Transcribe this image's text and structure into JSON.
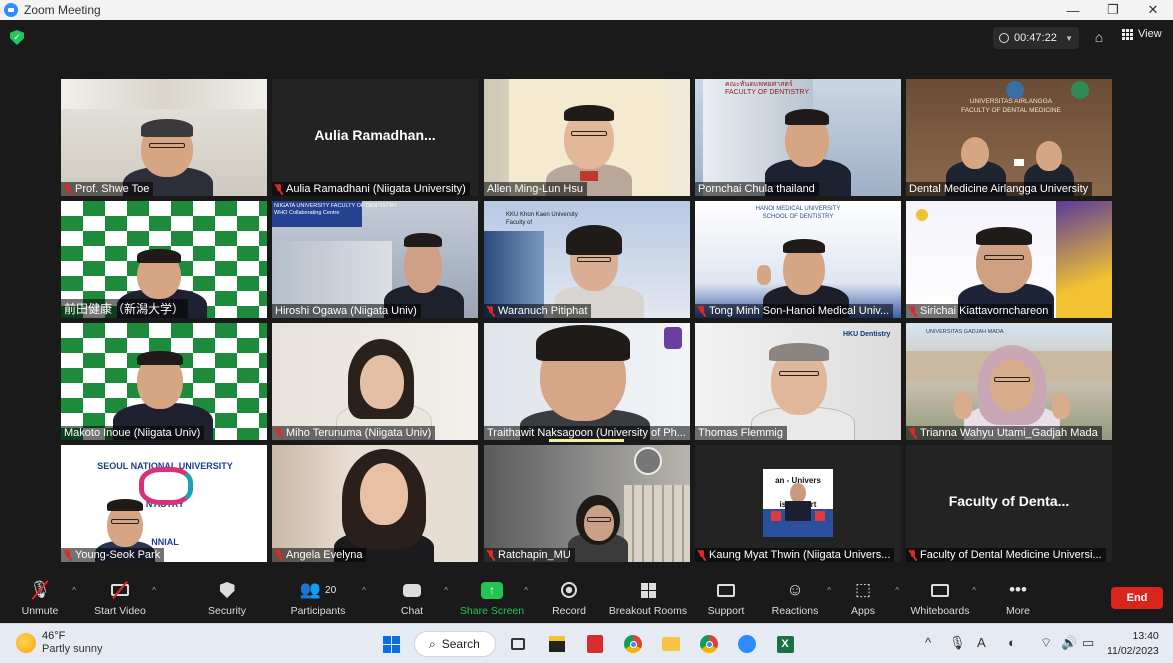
{
  "window": {
    "title": "Zoom Meeting"
  },
  "header": {
    "timer": "00:47:22",
    "view_label": "View"
  },
  "participants": [
    {
      "name": "Prof. Shwe Toe",
      "muted": true
    },
    {
      "name": "Aulia Ramadhani (Niigata University)",
      "muted": true,
      "display_text": "Aulia  Ramadhan..."
    },
    {
      "name": "Allen Ming-Lun Hsu",
      "muted": false
    },
    {
      "name": "Pornchai Chula thailand",
      "muted": false,
      "bg_text": "คณะทันตแพทยศาสตร์\nFACULTY OF DENTISTRY"
    },
    {
      "name": "Dental Medicine Airlangga University",
      "muted": false,
      "bg_text": "UNIVERSITAS AIRLANGGA\nFACULTY OF DENTAL MEDICINE"
    },
    {
      "name": "前田健康（新潟大学）",
      "muted": false,
      "active": true
    },
    {
      "name": "Hiroshi Ogawa (Niigata Univ)",
      "muted": false,
      "bg_text": "NIIGATA UNIVERSITY FACULTY OF DENTISTRY\nWHO Collaborating Centre"
    },
    {
      "name": "Waranuch Pitiphat",
      "muted": true,
      "bg_text": "KKU Khon Kaen University\nFaculty of"
    },
    {
      "name": "Tong Minh Son-Hanoi Medical Univ...",
      "muted": true,
      "bg_text": "HANOI MEDICAL UNIVERSITY\nSCHOOL OF DENTISTRY"
    },
    {
      "name": "Sirichai Kiattavornchareon",
      "muted": true
    },
    {
      "name": "Makoto Inoue (Niigata Univ)",
      "muted": false
    },
    {
      "name": "Miho Terunuma (Niigata Univ)",
      "muted": true
    },
    {
      "name": "Traithawit Naksagoon (University of Ph...",
      "muted": false
    },
    {
      "name": "Thomas Flemmig",
      "muted": false,
      "bg_text": "HKU Dentistry"
    },
    {
      "name": "Trianna Wahyu Utami_Gadjah Mada",
      "muted": true,
      "bg_text": "UNIVERSITAS GADJAH MADA"
    },
    {
      "name": "Young-Seok Park",
      "muted": true,
      "bg_text": "SEOUL NATIONAL UNIVERSITY\nNTISTRY\nNNIAL"
    },
    {
      "name": "Angela Evelyna",
      "muted": true
    },
    {
      "name": "Ratchapin_MU",
      "muted": true
    },
    {
      "name": "Kaung Myat Thwin (Niigata Univers...",
      "muted": true,
      "bg_text": "an - Univers\niscu  Kort"
    },
    {
      "name": "Faculty of Dental Medicine Universi...",
      "muted": true,
      "display_text": "Faculty of Denta..."
    }
  ],
  "toolbar": {
    "unmute": "Unmute",
    "start_video": "Start Video",
    "security": "Security",
    "participants": "Participants",
    "participants_count": "20",
    "chat": "Chat",
    "share_screen": "Share Screen",
    "record": "Record",
    "breakout_rooms": "Breakout Rooms",
    "support": "Support",
    "reactions": "Reactions",
    "apps": "Apps",
    "whiteboards": "Whiteboards",
    "more": "More",
    "end": "End"
  },
  "taskbar": {
    "weather_temp": "46°F",
    "weather_desc": "Partly sunny",
    "search_label": "Search",
    "time": "13:40",
    "date": "11/02/2023"
  },
  "colors": {
    "accent_green": "#23c552",
    "end_red": "#d9261c",
    "active_speaker": "#e8e24a",
    "muted_red": "#e02828"
  }
}
